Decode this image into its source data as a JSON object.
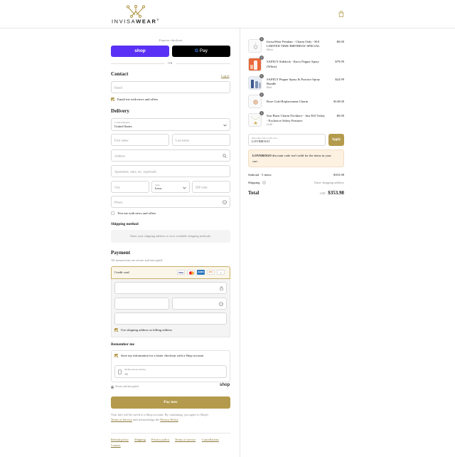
{
  "brand": {
    "name_light": "INVISA",
    "name_bold": "WEAR",
    "trademark": "®",
    "gold": "#b49a4c",
    "shop_purple": "#5a31f4"
  },
  "header": {
    "cart_icon": "shopping-bag-icon"
  },
  "express": {
    "title": "Express checkout",
    "shop_label": "shop",
    "gpay_g": "G",
    "gpay_label": "Pay",
    "or_label": "OR"
  },
  "contact": {
    "title": "Contact",
    "login_label": "Log in",
    "email_placeholder": "Email",
    "news_label": "Email me with news and offers",
    "news_checked": true
  },
  "delivery": {
    "title": "Delivery",
    "country_label": "Country/Region",
    "country_value": "United States",
    "first_name_placeholder": "First name",
    "last_name_placeholder": "Last name",
    "address_placeholder": "Address",
    "apartment_placeholder": "Apartment, suite, etc. (optional)",
    "city_placeholder": "City",
    "state_label": "State",
    "state_value": "Iowa",
    "zip_placeholder": "ZIP code",
    "phone_placeholder": "Phone",
    "text_label": "Text me with news and offers",
    "text_checked": false
  },
  "shipping_method": {
    "title": "Shipping method",
    "message": "Enter your shipping address to view available shipping methods."
  },
  "payment": {
    "title": "Payment",
    "subtitle": "All transactions are secure and encrypted.",
    "method_label": "Credit card",
    "cards": [
      "VISA",
      "MC",
      "AMEX",
      "DISC"
    ],
    "more_cards": "+",
    "billing_label": "Use shipping address as billing address",
    "billing_checked": true
  },
  "remember": {
    "title": "Remember me",
    "save_label": "Save my information for a faster checkout with a Shop account",
    "save_checked": true,
    "mobile_label": "Mobile phone number",
    "mobile_value": "+1",
    "secure_label": "Secure and encrypted",
    "shop_label": "shop"
  },
  "pay_now": "Pay now",
  "legal": {
    "line1": "Your info will be saved to a Shop account. By continuing, you agree to Shop's",
    "terms": "Terms of Service",
    "and_text": "and acknowledge the",
    "privacy": "Privacy Policy",
    "period": "."
  },
  "footer_links": [
    "Refund policy",
    "Shipping",
    "Privacy policy",
    "Terms of service",
    "Cancellations",
    "Contact"
  ],
  "order": {
    "items": [
      {
        "qty": "1",
        "name_line1": "InvisaWear Pendant - Charm Only - $10",
        "name_line2": "LIMITED TIME BIRTHDAY SPECIAL",
        "variant": "Silver",
        "price": "$0.00"
      },
      {
        "qty": "1",
        "name_line1": "SAFELY Sidekick - Knox Pepper Spray",
        "name_line2": "(White)",
        "variant": "",
        "price": "$79.99"
      },
      {
        "qty": "1",
        "name_line1": "SAFELY Pepper Spray & Practice Spray",
        "name_line2": "Bundle",
        "variant": "Blue",
        "price": "$24.99"
      },
      {
        "qty": "1",
        "name_line1": "Rose Gold Replacement Charm",
        "name_line2": "",
        "variant": "",
        "price": "$149.00"
      },
      {
        "qty": "1",
        "name_line1": "Star Burst Charm Necklace - Just $10 Today",
        "name_line2": "- Exclusive Safety Features",
        "variant": "Gold",
        "price": "$0.00"
      }
    ],
    "discount_label": "Discount code or gift card",
    "discount_value": "LOVEBOGO",
    "apply_label": "Apply",
    "warning_code": "LOVEBOGO",
    "warning_rest_line1": "discount code isn't valid for the items in your",
    "warning_rest_line2": "cart",
    "subtotal_label": "Subtotal · 5 items",
    "subtotal_value": "$353.98",
    "shipping_label": "Shipping",
    "shipping_value": "Enter shipping address",
    "total_label": "Total",
    "currency": "USD",
    "total_value": "$353.98"
  }
}
